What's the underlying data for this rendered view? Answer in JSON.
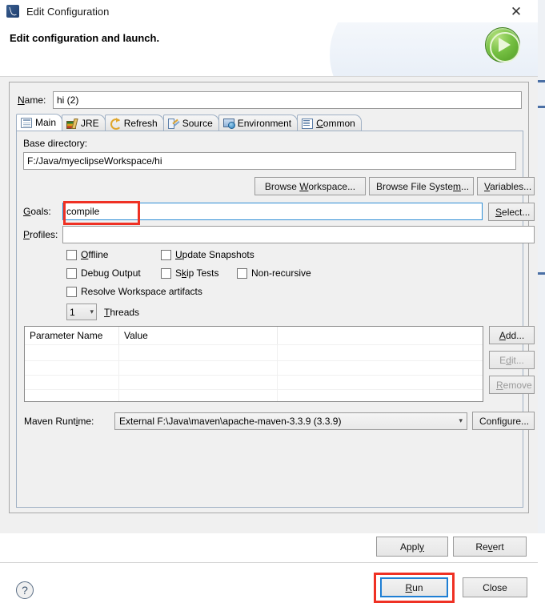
{
  "window": {
    "title": "Edit Configuration",
    "icon": "maven-launch-icon",
    "close_label": "✕"
  },
  "header": {
    "title": "Edit configuration and launch.",
    "badge_icon": "run-green-play-icon"
  },
  "form": {
    "name_label": "Name:",
    "name_value": "hi (2)"
  },
  "tabs": [
    {
      "label": "Main",
      "icon": "main-document-icon",
      "active": true
    },
    {
      "label": "JRE",
      "icon": "jre-books-icon",
      "active": false
    },
    {
      "label": "Refresh",
      "icon": "refresh-arrows-icon",
      "active": false
    },
    {
      "label": "Source",
      "icon": "source-edit-icon",
      "active": false
    },
    {
      "label": "Environment",
      "icon": "environment-icon",
      "active": false
    },
    {
      "label": "Common",
      "icon": "common-list-icon",
      "active": false
    }
  ],
  "main_tab": {
    "base_directory_label": "Base directory:",
    "base_directory_value": "F:/Java/myeclipseWorkspace/hi",
    "browse_workspace_label": "Browse Workspace...",
    "browse_filesystem_label": "Browse File System...",
    "variables_label": "Variables...",
    "goals_label": "Goals:",
    "goals_value": "compile",
    "select_label": "Select...",
    "profiles_label": "Profiles:",
    "profiles_value": "",
    "checkboxes": [
      {
        "label": "Offline",
        "checked": false
      },
      {
        "label": "Update Snapshots",
        "checked": false
      },
      {
        "label": "Debug Output",
        "checked": false
      },
      {
        "label": "Skip Tests",
        "checked": false
      },
      {
        "label": "Non-recursive",
        "checked": false
      },
      {
        "label": "Resolve Workspace artifacts",
        "checked": false
      }
    ],
    "threads_value": "1",
    "threads_label": "Threads",
    "table": {
      "columns": [
        "Parameter Name",
        "Value",
        ""
      ],
      "rows": []
    },
    "add_label": "Add...",
    "edit_label": "Edit...",
    "remove_label": "Remove",
    "maven_runtime_label": "Maven Runtime:",
    "maven_runtime_value": "External F:\\Java\\maven\\apache-maven-3.3.9 (3.3.9)",
    "configure_label": "Configure..."
  },
  "actions": {
    "apply_label": "Apply",
    "revert_label": "Revert",
    "run_label": "Run",
    "close_label": "Close",
    "help_icon": "question-mark-icon"
  },
  "annotations": {
    "goals_highlight_color": "#ef3124",
    "run_highlight_color": "#ef3124",
    "focus_border_color": "#1f7fd4"
  }
}
